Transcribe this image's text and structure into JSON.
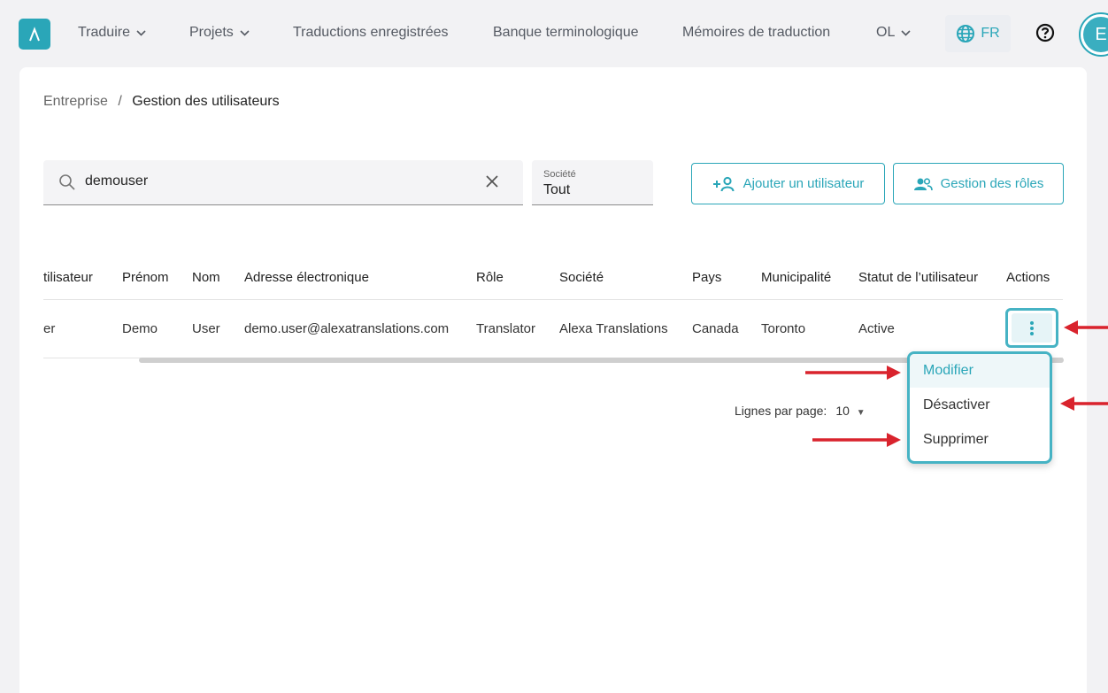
{
  "nav": {
    "items": [
      {
        "label": "Traduire",
        "has_chevron": true
      },
      {
        "label": "Projets",
        "has_chevron": true
      },
      {
        "label": "Traductions enregistrées",
        "has_chevron": false
      },
      {
        "label": "Banque terminologique",
        "has_chevron": false
      },
      {
        "label": "Mémoires de traduction",
        "has_chevron": false
      },
      {
        "label": "OL",
        "has_chevron": true
      }
    ],
    "language": "FR",
    "avatar_initial": "E"
  },
  "breadcrumb": {
    "parent": "Entreprise",
    "separator": "/",
    "current": "Gestion des utilisateurs"
  },
  "search": {
    "value": "demouser"
  },
  "company_filter": {
    "label": "Société",
    "value": "Tout"
  },
  "buttons": {
    "add_user": "Ajouter un utilisateur",
    "manage_roles": "Gestion des rôles"
  },
  "table": {
    "headers": [
      "tilisateur",
      "Prénom",
      "Nom",
      "Adresse électronique",
      "Rôle",
      "Société",
      "Pays",
      "Municipalité",
      "Statut de l’utilisateur",
      "Actions"
    ],
    "rows": [
      [
        "er",
        "Demo",
        "User",
        "demo.user@alexatranslations.com",
        "Translator",
        "Alexa Translations",
        "Canada",
        "Toronto",
        "Active"
      ]
    ]
  },
  "pagination": {
    "rows_per_page_label": "Lignes par page:",
    "rows_per_page_value": "10"
  },
  "actions_menu": {
    "items": [
      "Modifier",
      "Désactiver",
      "Supprimer"
    ]
  },
  "colors": {
    "accent": "#2aa6b8",
    "annotation_arrow": "#d9232d"
  }
}
